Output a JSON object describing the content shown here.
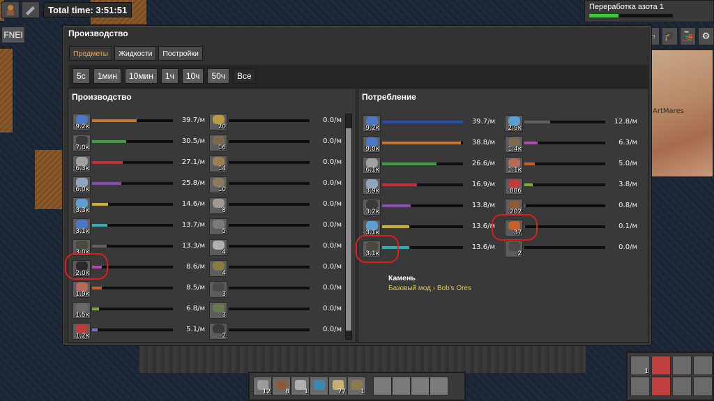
{
  "hud": {
    "total_time": "Total time: 3:51:51",
    "fnei": "FNEI"
  },
  "research": {
    "title": "Переработка азота 1",
    "progress": 0.35
  },
  "minimap": {
    "label": "ArtMares"
  },
  "window": {
    "title": "Производство",
    "tabs": [
      {
        "label": "Предметы",
        "active": true
      },
      {
        "label": "Жидкости",
        "active": false
      },
      {
        "label": "Постройки",
        "active": false
      }
    ],
    "ranges": [
      {
        "label": "5с",
        "active": false
      },
      {
        "label": "1мин",
        "active": false
      },
      {
        "label": "10мин",
        "active": false
      },
      {
        "label": "1ч",
        "active": false
      },
      {
        "label": "10ч",
        "active": false
      },
      {
        "label": "50ч",
        "active": false
      },
      {
        "label": "Все",
        "active": true
      }
    ]
  },
  "production": {
    "title": "Производство",
    "col_a": [
      {
        "count": "9.2к",
        "rate": "39.7/м",
        "fill": 0.55,
        "color": "#c8772a",
        "icon": "#4a78c8"
      },
      {
        "count": "7.0к",
        "rate": "30.5/м",
        "fill": 0.42,
        "color": "#3ea04a",
        "icon": "#3a3a3a"
      },
      {
        "count": "6.3к",
        "rate": "27.1/м",
        "fill": 0.38,
        "color": "#c0303a",
        "icon": "#a0a0a0"
      },
      {
        "count": "6.0к",
        "rate": "25.8/м",
        "fill": 0.36,
        "color": "#8a4ab0",
        "icon": "#8fa6c0"
      },
      {
        "count": "3.3к",
        "rate": "14.6/м",
        "fill": 0.2,
        "color": "#c8b02a",
        "icon": "#5aa0d0"
      },
      {
        "count": "3.1к",
        "rate": "13.7/м",
        "fill": 0.19,
        "color": "#2ab0b0",
        "icon": "#4a78c8"
      },
      {
        "count": "3.0к",
        "rate": "13.3/м",
        "fill": 0.18,
        "color": "#606060",
        "icon": "#4a4a3a"
      },
      {
        "count": "2.0к",
        "rate": "8.6/м",
        "fill": 0.12,
        "color": "#b04ab0",
        "icon": "#2a2a2a"
      },
      {
        "count": "1.9к",
        "rate": "8.5/м",
        "fill": 0.12,
        "color": "#c8602a",
        "icon": "#b86a5a"
      },
      {
        "count": "1.5к",
        "rate": "6.8/м",
        "fill": 0.09,
        "color": "#7ab02a",
        "icon": "#6a6a6a"
      },
      {
        "count": "1.2к",
        "rate": "5.1/м",
        "fill": 0.07,
        "color": "#6a7ac8",
        "icon": "#c03a3a"
      }
    ],
    "col_b": [
      {
        "count": "20",
        "rate": "0.0/м",
        "fill": 0,
        "color": "#606060",
        "icon": "#b89a40"
      },
      {
        "count": "16",
        "rate": "0.0/м",
        "fill": 0,
        "color": "#606060",
        "icon": "#7a6a50"
      },
      {
        "count": "14",
        "rate": "0.0/м",
        "fill": 0,
        "color": "#606060",
        "icon": "#9a8050"
      },
      {
        "count": "10",
        "rate": "0.0/м",
        "fill": 0,
        "color": "#606060",
        "icon": "#8a7a60"
      },
      {
        "count": "8",
        "rate": "0.0/м",
        "fill": 0,
        "color": "#606060",
        "icon": "#a09a90"
      },
      {
        "count": "5",
        "rate": "0.0/м",
        "fill": 0,
        "color": "#606060",
        "icon": "#7a7a7a"
      },
      {
        "count": "4",
        "rate": "0.0/м",
        "fill": 0,
        "color": "#606060",
        "icon": "#b0b0b0"
      },
      {
        "count": "4",
        "rate": "0.0/м",
        "fill": 0,
        "color": "#606060",
        "icon": "#8a7a40"
      },
      {
        "count": "3",
        "rate": "0.0/м",
        "fill": 0,
        "color": "#606060",
        "icon": "#4a4a4a"
      },
      {
        "count": "3",
        "rate": "0.0/м",
        "fill": 0,
        "color": "#606060",
        "icon": "#6a7a50"
      },
      {
        "count": "2",
        "rate": "0.0/м",
        "fill": 0,
        "color": "#606060",
        "icon": "#3a3a3a"
      }
    ]
  },
  "consumption": {
    "title": "Потребление",
    "col_a": [
      {
        "count": "9.2к",
        "rate": "39.7/м",
        "fill": 1.0,
        "color": "#2a4ab0",
        "icon": "#4a78c8"
      },
      {
        "count": "9.0к",
        "rate": "38.8/м",
        "fill": 0.97,
        "color": "#c8772a",
        "icon": "#4a78c8"
      },
      {
        "count": "6.1к",
        "rate": "26.6/м",
        "fill": 0.67,
        "color": "#3ea04a",
        "icon": "#a0a0a0"
      },
      {
        "count": "3.9к",
        "rate": "16.9/м",
        "fill": 0.43,
        "color": "#c0303a",
        "icon": "#8fa6c0"
      },
      {
        "count": "3.2к",
        "rate": "13.8/м",
        "fill": 0.35,
        "color": "#8a4ab0",
        "icon": "#3a3a3a"
      },
      {
        "count": "3.1к",
        "rate": "13.6/м",
        "fill": 0.34,
        "color": "#c8b02a",
        "icon": "#5aa0d0"
      },
      {
        "count": "3.1к",
        "rate": "13.6/м",
        "fill": 0.34,
        "color": "#2ab0b0",
        "icon": "#4a4a3a"
      }
    ],
    "col_b": [
      {
        "count": "2.9к",
        "rate": "12.8/м",
        "fill": 0.32,
        "color": "#606060",
        "icon": "#5aa0d0"
      },
      {
        "count": "1.4к",
        "rate": "6.3/м",
        "fill": 0.16,
        "color": "#b04ab0",
        "icon": "#7a6a50"
      },
      {
        "count": "1.1к",
        "rate": "5.0/м",
        "fill": 0.13,
        "color": "#c8602a",
        "icon": "#b86a5a"
      },
      {
        "count": "886",
        "rate": "3.8/м",
        "fill": 0.1,
        "color": "#7ab02a",
        "icon": "#c03a3a"
      },
      {
        "count": "202",
        "rate": "0.8/м",
        "fill": 0.02,
        "color": "#606060",
        "icon": "#8a5a3a"
      },
      {
        "count": "37",
        "rate": "0.1/м",
        "fill": 0.01,
        "color": "#606060",
        "icon": "#c8602a"
      },
      {
        "count": "2",
        "rate": "0.0/м",
        "fill": 0,
        "color": "#606060",
        "icon": "#4a4a4a"
      }
    ],
    "tooltip": {
      "name": "Камень",
      "mod": "Базовый мод › Bob's Ores"
    }
  },
  "quickbar": [
    {
      "count": "12",
      "color": "#9a9a9a"
    },
    {
      "count": "8",
      "color": "#8a5a3a"
    },
    {
      "count": "1",
      "color": "#b0b0b0"
    },
    {
      "count": "",
      "color": "#3a8ab0"
    },
    {
      "count": "77",
      "color": "#c8b070"
    },
    {
      "count": "1",
      "color": "#8a7a50"
    },
    {
      "count": "",
      "color": ""
    },
    {
      "count": "",
      "color": ""
    },
    {
      "count": "",
      "color": ""
    },
    {
      "count": "",
      "color": ""
    }
  ],
  "gun_panel": [
    {
      "count": "1",
      "state": "pick"
    },
    {
      "count": "",
      "state": "red"
    },
    {
      "count": "",
      "state": "empty"
    },
    {
      "count": "",
      "state": "empty"
    },
    {
      "count": "",
      "state": "ammo"
    },
    {
      "count": "",
      "state": "red"
    },
    {
      "count": "",
      "state": "empty"
    },
    {
      "count": "",
      "state": "empty"
    }
  ]
}
